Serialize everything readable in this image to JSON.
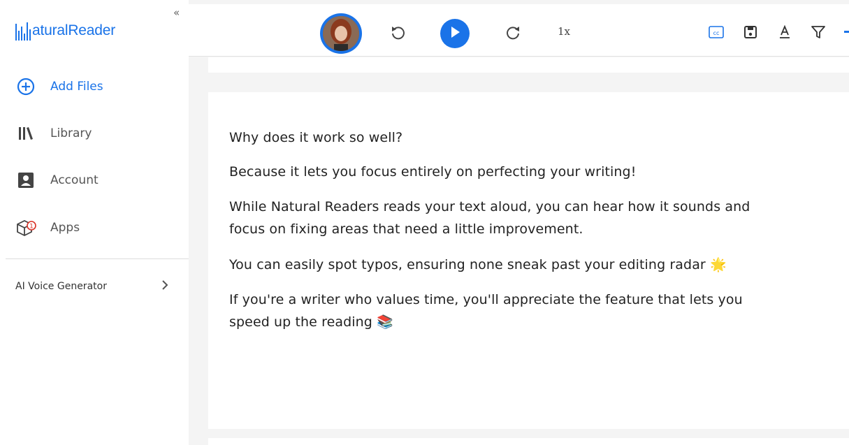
{
  "app": {
    "logo_text": "aturalReader",
    "collapse_glyph": "«"
  },
  "sidebar": {
    "items": [
      {
        "label": "Add Files",
        "icon": "add-circle-icon"
      },
      {
        "label": "Library",
        "icon": "library-icon"
      },
      {
        "label": "Account",
        "icon": "account-icon"
      },
      {
        "label": "Apps",
        "icon": "apps-icon",
        "badge": "1"
      }
    ],
    "ai_voice_generator": "AI Voice Generator"
  },
  "toolbar": {
    "speed": "1x",
    "icons": [
      "avatar",
      "rewind-icon",
      "play-icon",
      "forward-icon",
      "cc-icon",
      "save-icon",
      "font-icon",
      "filter-icon"
    ]
  },
  "colors": {
    "accent": "#1a73e8",
    "text": "#222222",
    "background": "#f4f4f4"
  },
  "document": {
    "paragraphs": [
      "Why does it work so well?",
      "Because it lets you focus entirely on perfecting your writing!",
      "While Natural Readers reads your text aloud, you can hear how it sounds and",
      "focus on fixing areas that need a little improvement.",
      "You can easily spot typos, ensuring none sneak past your editing radar 🌟",
      "If you're a writer who values time, you'll appreciate the feature that lets you",
      "speed up the reading 📚"
    ]
  }
}
